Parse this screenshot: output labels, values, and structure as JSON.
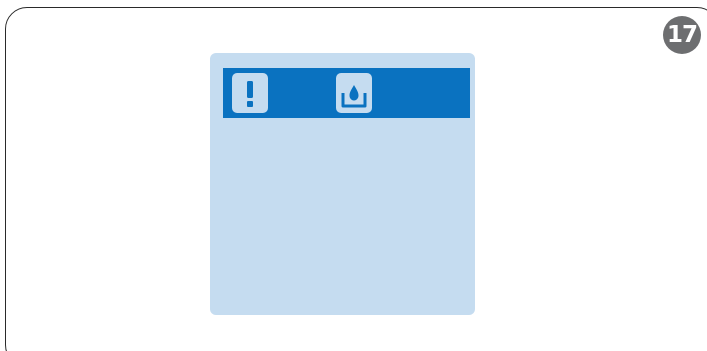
{
  "step": {
    "number": "17"
  },
  "display": {
    "status_bar": {
      "icons": [
        {
          "name": "warning-exclamation-icon",
          "color": "#0a72c0"
        },
        {
          "name": "water-tank-icon",
          "color": "#0a72c0"
        }
      ]
    }
  },
  "colors": {
    "screen_background": "#c5dcf0",
    "status_bar": "#0a72c0",
    "badge": "#6d6e70",
    "frame_border": "#2a2a2a"
  }
}
